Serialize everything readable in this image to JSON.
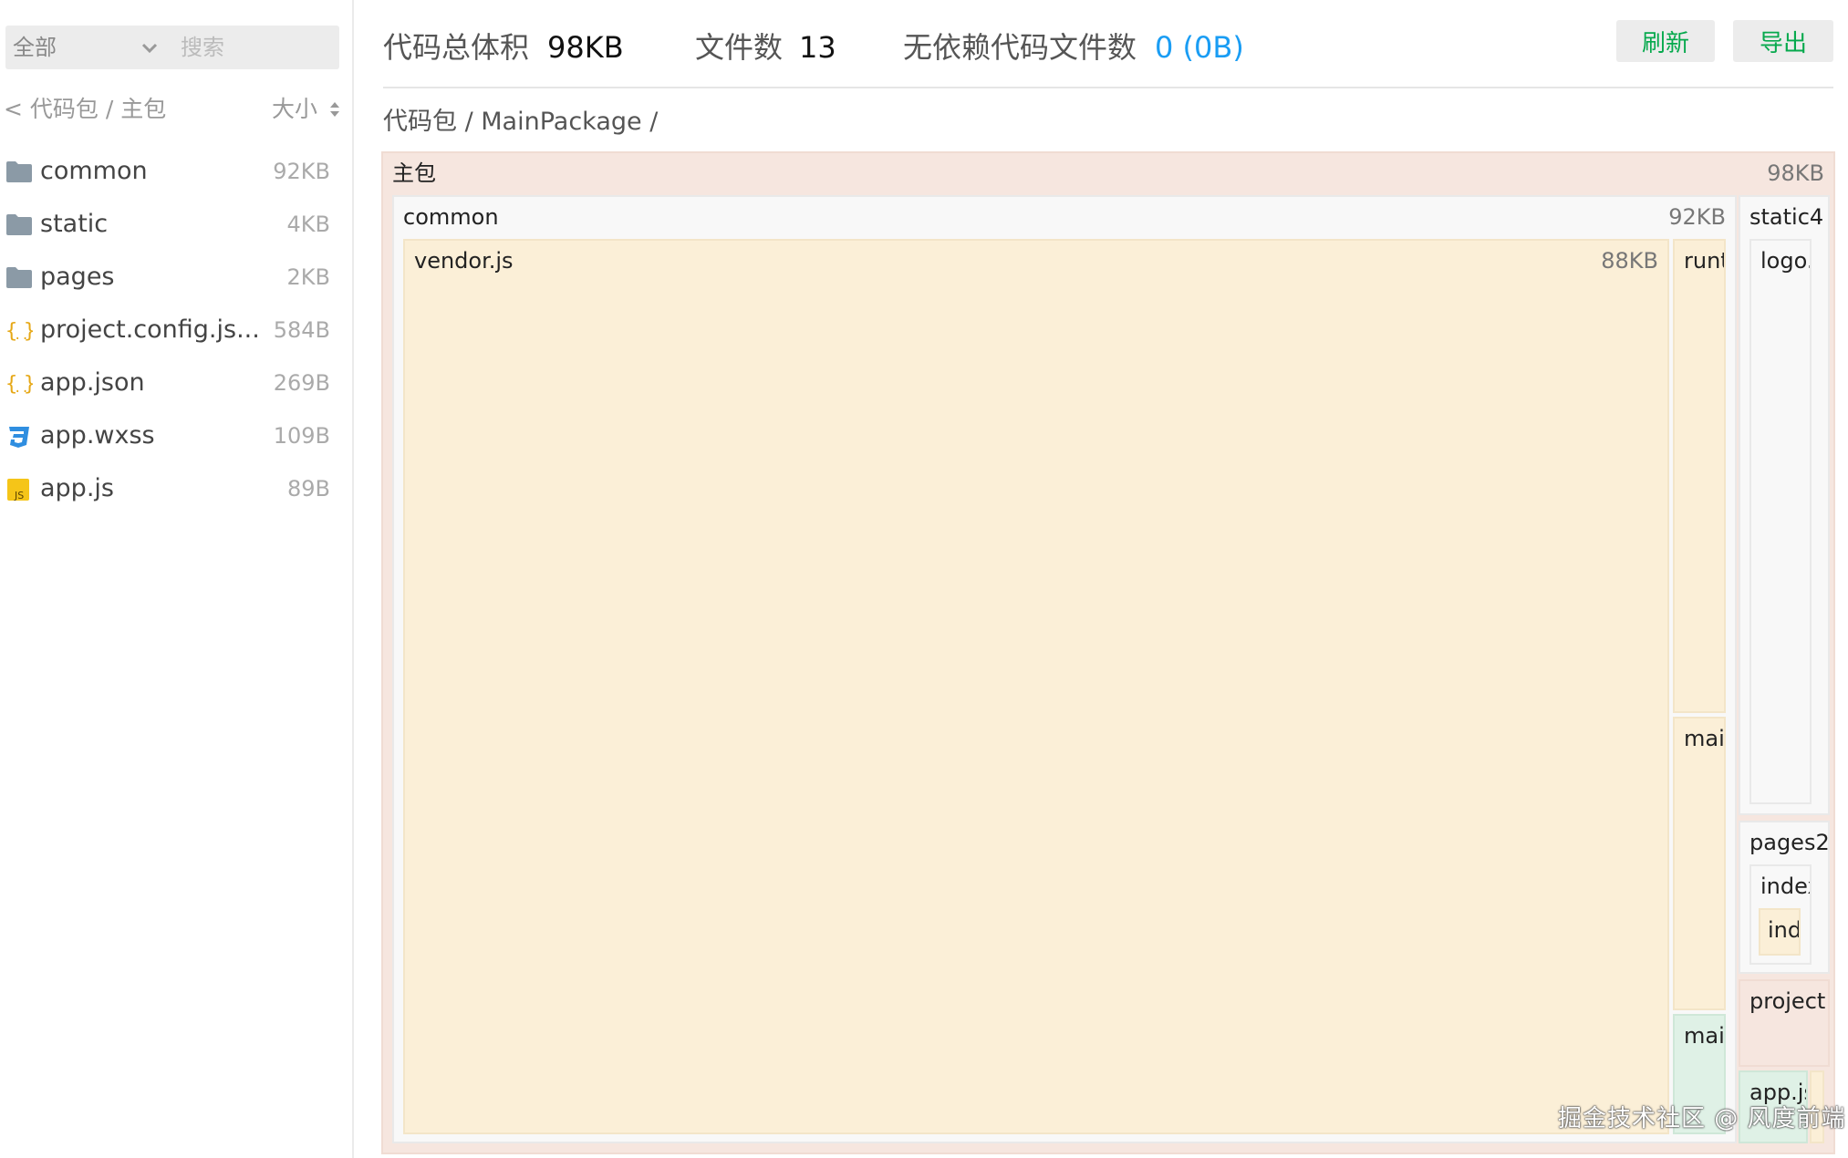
{
  "sidebar": {
    "scope_value": "全部",
    "search_placeholder": "搜索",
    "back_link": "< 代码包 / 主包",
    "sort_label": "大小",
    "items": [
      {
        "name": "common",
        "size": "92KB",
        "icon": "folder-icon"
      },
      {
        "name": "static",
        "size": "4KB",
        "icon": "folder-icon"
      },
      {
        "name": "pages",
        "size": "2KB",
        "icon": "folder-icon"
      },
      {
        "name": "project.config.js...",
        "size": "584B",
        "icon": "json-file-icon"
      },
      {
        "name": "app.json",
        "size": "269B",
        "icon": "json-file-icon"
      },
      {
        "name": "app.wxss",
        "size": "109B",
        "icon": "css-file-icon"
      },
      {
        "name": "app.js",
        "size": "89B",
        "icon": "js-file-icon"
      }
    ]
  },
  "header": {
    "total_size_label": "代码总体积",
    "total_size_value": "98KB",
    "file_count_label": "文件数",
    "file_count_value": "13",
    "nodep_label": "无依赖代码文件数",
    "nodep_value": "0 (0B)",
    "refresh_button": "刷新",
    "export_button": "导出"
  },
  "breadcrumb": "代码包 / MainPackage /",
  "treemap": {
    "root": {
      "label": "主包",
      "size": "98KB"
    },
    "common": {
      "label": "common",
      "size": "92KB"
    },
    "vendor": {
      "label": "vendor.js",
      "size": "88KB"
    },
    "runtime": {
      "label": "runt"
    },
    "main1": {
      "label": "mai"
    },
    "main2": {
      "label": "mai"
    },
    "static": {
      "label": "static4"
    },
    "logo": {
      "label": "logo."
    },
    "pages": {
      "label": "pages2"
    },
    "index_dir": {
      "label": "index"
    },
    "index_file": {
      "label": "ind"
    },
    "project": {
      "label": "project"
    },
    "appjs": {
      "label": "app.js"
    }
  },
  "watermark": "掘金技术社区 @ 风度前端",
  "colors": {
    "accent_green": "#06a94d",
    "accent_blue": "#1a9df4",
    "node_pink": "#f6e6df",
    "node_cream": "#fbefd7",
    "node_grey": "#f8f8f8",
    "node_mint": "#dff1e6"
  }
}
